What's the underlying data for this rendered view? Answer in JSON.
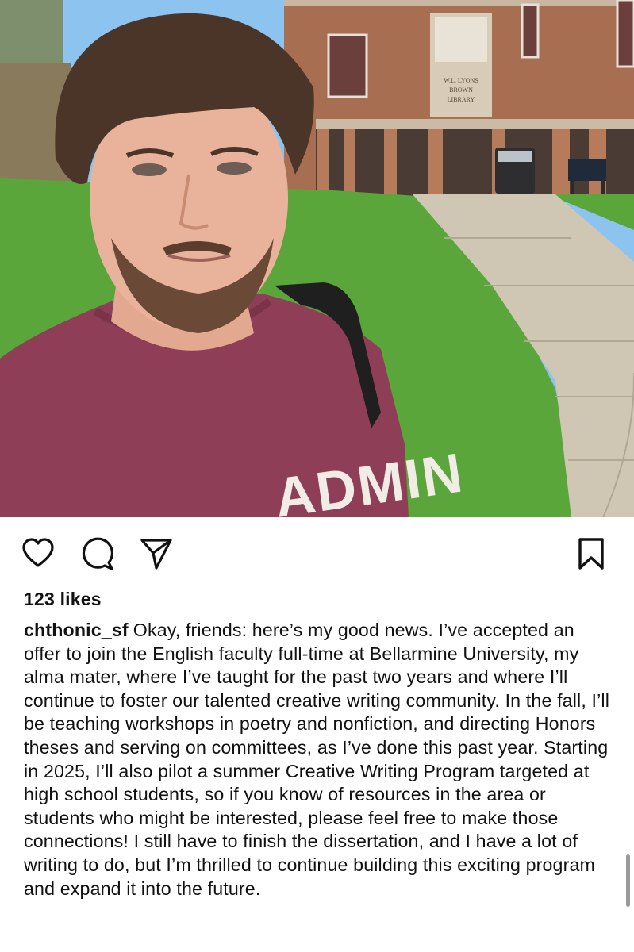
{
  "post": {
    "image": {
      "sign_text": [
        "W.L. LYONS",
        "BROWN",
        "LIBRARY"
      ],
      "shirt_text": "ADMIN"
    },
    "actions": {
      "like_icon": "heart-icon",
      "comment_icon": "comment-icon",
      "share_icon": "paper-plane-icon",
      "save_icon": "bookmark-icon"
    },
    "likes": "123 likes",
    "username": "chthonic_sf",
    "caption": "Okay, friends: here’s my good news. I’ve accepted an offer to join the English faculty full-time at Bellarmine University, my alma mater, where I’ve taught for the past two years and where I’ll continue to foster our talented creative writing community. In the fall, I’ll be teaching workshops in poetry and nonfiction, and directing Honors theses and serving on committees, as I’ve done this past year. Starting in 2025, I’ll also pilot a summer Creative Writing Program targeted at high school students, so if you know of resources in the area or students who might be interested, please feel free to make those connections! I still have to finish the dissertation, and I have a lot of writing to do, but I’m thrilled to continue building this exciting program and expand it into the future."
  },
  "colors": {
    "text": "#111111",
    "background": "#ffffff",
    "shirt": "#8e3f57",
    "grass": "#5aa63a",
    "brick": "#a86e52"
  }
}
